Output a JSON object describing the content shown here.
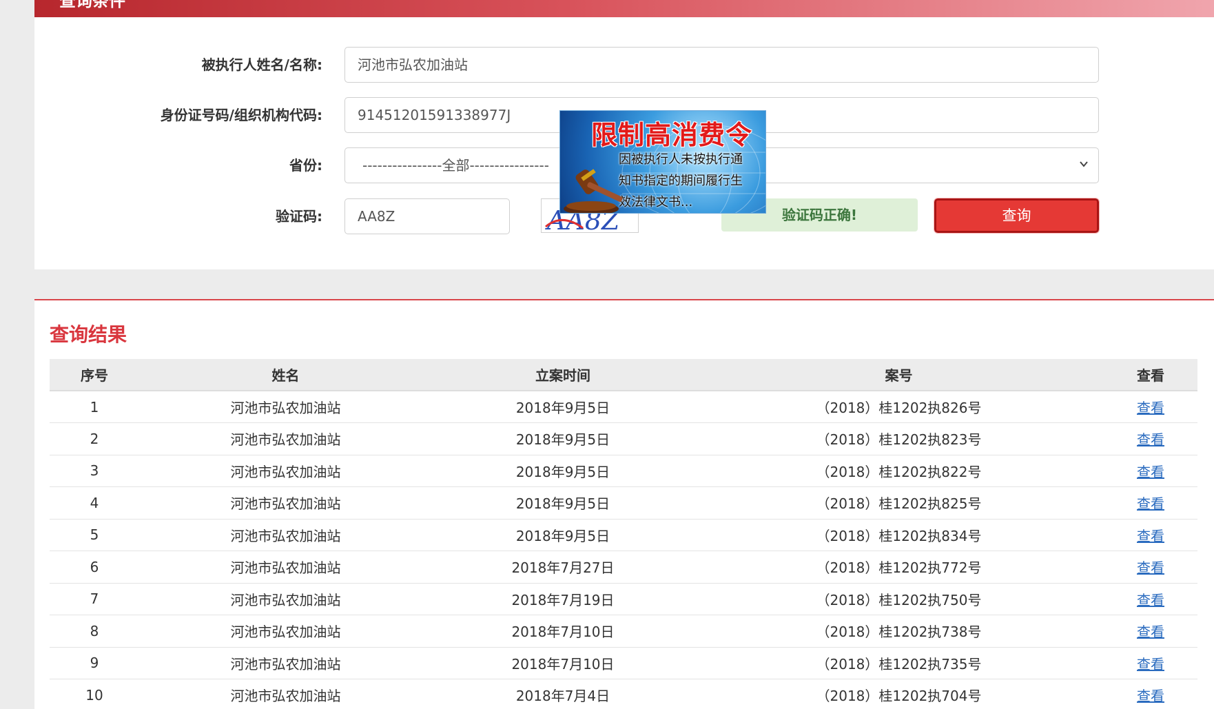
{
  "query_panel": {
    "title": "查询条件",
    "fields": {
      "name_label": "被执行人姓名/名称:",
      "name_value": "河池市弘农加油站",
      "id_label": "身份证号码/组织机构代码:",
      "id_value": "91451201591338977J",
      "province_label": "省份:",
      "province_value": "----------------全部----------------",
      "captcha_label": "验证码:",
      "captcha_value": "AA8Z",
      "captcha_image_text": "AA8Z"
    },
    "captcha_status": "验证码正确!",
    "query_button": "查询"
  },
  "popup": {
    "title": "限制高消费令",
    "lines": [
      "因被执行人未按执行通",
      "知书指定的期间履行生",
      "效法律文书..."
    ]
  },
  "results": {
    "title": "查询结果",
    "columns": [
      "序号",
      "姓名",
      "立案时间",
      "案号",
      "查看"
    ],
    "rows": [
      {
        "index": "1",
        "name": "河池市弘农加油站",
        "date": "2018年9月5日",
        "case": "（2018）桂1202执826号",
        "view": "查看"
      },
      {
        "index": "2",
        "name": "河池市弘农加油站",
        "date": "2018年9月5日",
        "case": "（2018）桂1202执823号",
        "view": "查看"
      },
      {
        "index": "3",
        "name": "河池市弘农加油站",
        "date": "2018年9月5日",
        "case": "（2018）桂1202执822号",
        "view": "查看"
      },
      {
        "index": "4",
        "name": "河池市弘农加油站",
        "date": "2018年9月5日",
        "case": "（2018）桂1202执825号",
        "view": "查看"
      },
      {
        "index": "5",
        "name": "河池市弘农加油站",
        "date": "2018年9月5日",
        "case": "（2018）桂1202执834号",
        "view": "查看"
      },
      {
        "index": "6",
        "name": "河池市弘农加油站",
        "date": "2018年7月27日",
        "case": "（2018）桂1202执772号",
        "view": "查看"
      },
      {
        "index": "7",
        "name": "河池市弘农加油站",
        "date": "2018年7月19日",
        "case": "（2018）桂1202执750号",
        "view": "查看"
      },
      {
        "index": "8",
        "name": "河池市弘农加油站",
        "date": "2018年7月10日",
        "case": "（2018）桂1202执738号",
        "view": "查看"
      },
      {
        "index": "9",
        "name": "河池市弘农加油站",
        "date": "2018年7月10日",
        "case": "（2018）桂1202执735号",
        "view": "查看"
      },
      {
        "index": "10",
        "name": "河池市弘农加油站",
        "date": "2018年7月4日",
        "case": "（2018）桂1202执704号",
        "view": "查看"
      }
    ]
  },
  "colors": {
    "accent_red": "#d9363e",
    "success_bg": "#dff0d8",
    "success_text": "#3c763d",
    "link_blue": "#2a6bbf"
  }
}
